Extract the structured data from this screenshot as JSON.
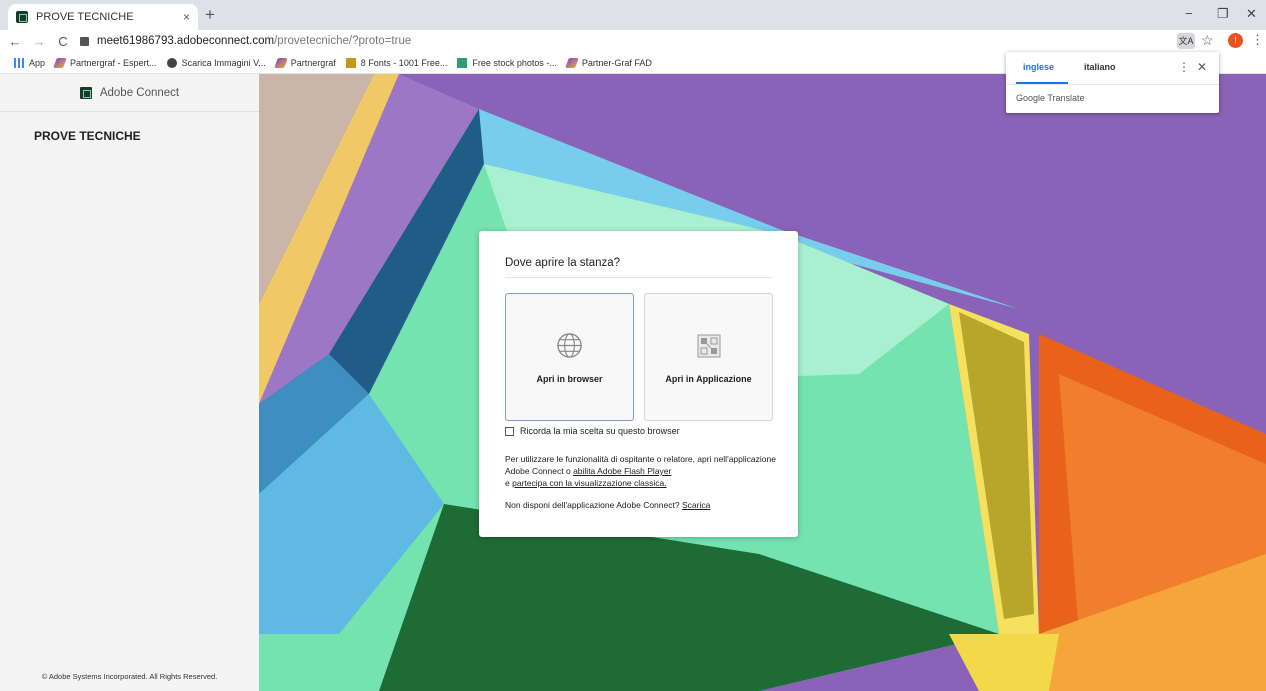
{
  "browser": {
    "tab_title": "PROVE TECNICHE",
    "tab_close": "×",
    "new_tab": "+",
    "url_host": "meet61986793.adobeconnect.com",
    "url_path": "/provetecniche/?proto=true",
    "nav_back": "←",
    "nav_forward": "→",
    "nav_reload": "C",
    "star": "☆",
    "profile_initial": "!",
    "menu": "⋮",
    "window_min": "−",
    "window_max": "❐",
    "window_close": "✕",
    "bookmarks": [
      {
        "label": "App",
        "icon": "apps-icon"
      },
      {
        "label": "Partnergraf - Espert...",
        "icon": "partnergraf-icon"
      },
      {
        "label": "Scarica Immagini V...",
        "icon": "globe-icon"
      },
      {
        "label": "Partnergraf",
        "icon": "partnergraf-icon"
      },
      {
        "label": "8 Fonts - 1001 Free...",
        "icon": "fonts-icon"
      },
      {
        "label": "Free stock photos -...",
        "icon": "stock-icon"
      },
      {
        "label": "Partner-Graf FAD",
        "icon": "partnergraf-icon"
      }
    ]
  },
  "translate": {
    "lang_source": "inglese",
    "lang_target": "italiano",
    "brand": "Google Translate",
    "menu": "⋮",
    "close": "✕"
  },
  "sidebar": {
    "brand": "Adobe Connect",
    "room_title": "PROVE TECNICHE",
    "copyright": "© Adobe Systems Incorporated. All Rights Reserved."
  },
  "dialog": {
    "title": "Dove aprire la stanza?",
    "option_browser": "Apri in browser",
    "option_app": "Apri in Applicazione",
    "remember": "Ricorda la mia scelta su questo browser",
    "info_text_1": "Per utilizzare le funzionalità di ospitante o relatore, apri nell'applicazione Adobe Connect o",
    "info_link_flash": "abilita Adobe Flash Player",
    "info_text_2": "e",
    "info_link_classic": "partecipa con la visualizzazione classica.",
    "download_text": "Non disponi dell'applicazione Adobe Connect?",
    "download_link": "Scarica"
  },
  "colors": {
    "accent": "#1a73e8",
    "brand_dark": "#1b3a2f",
    "purple": "#8a62b7",
    "green": "#74e3b0",
    "orange": "#e8621c",
    "yellow": "#f3d94a"
  }
}
